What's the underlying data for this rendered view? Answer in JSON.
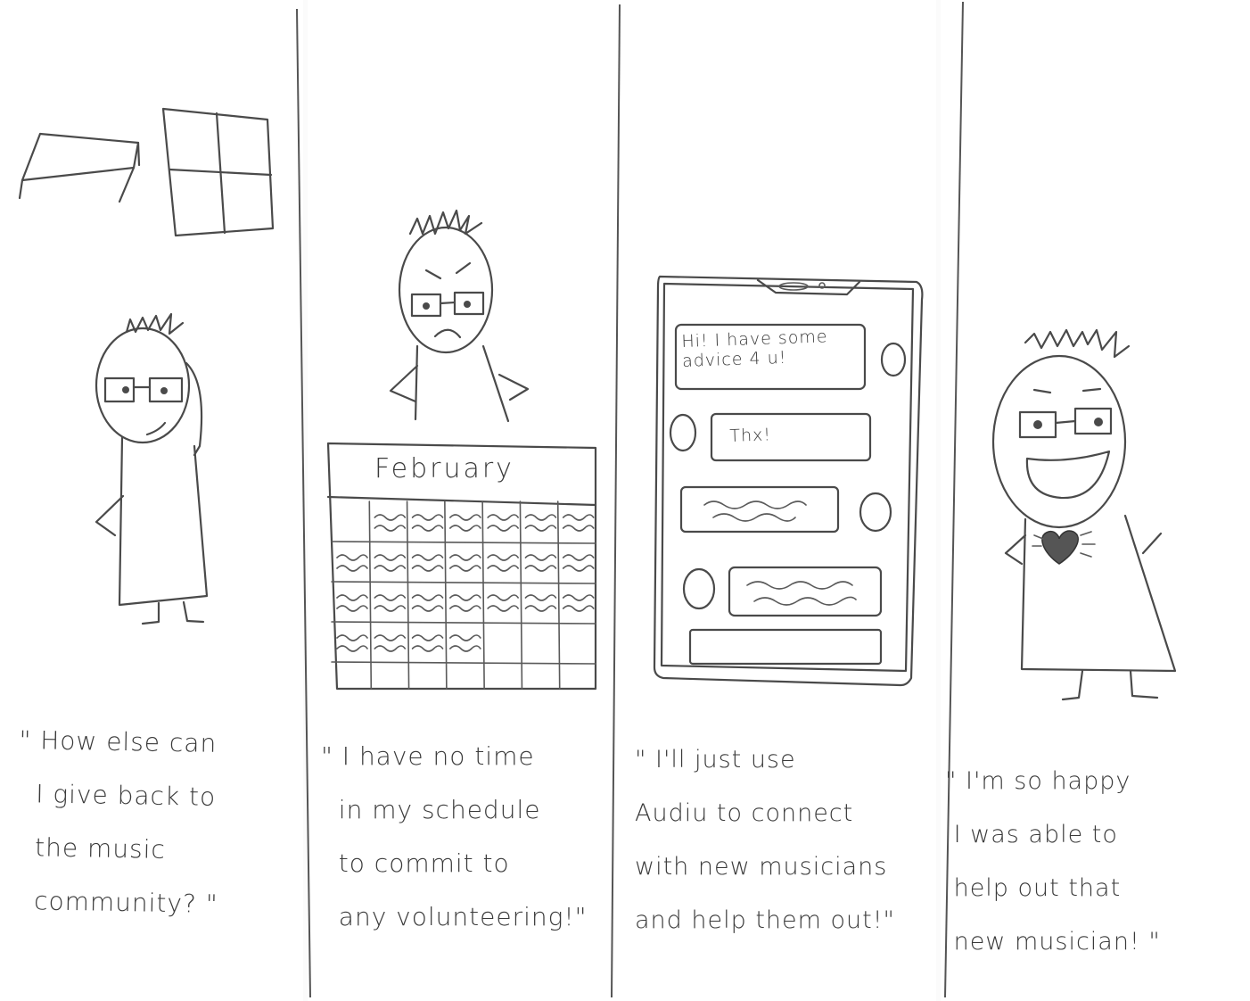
{
  "panels": [
    {
      "caption": "\" How else can\n  I give back to\n  the music\n  community? \""
    },
    {
      "calendar_month": "February",
      "caption": "\" I have no time\n  in my schedule\n  to commit to\n  any volunteering!\""
    },
    {
      "chat": {
        "incoming_message": "Hi! I have some\nadvice 4 u!",
        "reply_message": "Thx!"
      },
      "caption": "\" I'll just use\nAudiu to connect\nwith new musicians\nand help them out!\""
    },
    {
      "caption": "\" I'm so happy\n I was able to\n help out that\n new musician! \""
    }
  ],
  "calendar_chart": {
    "type": "table",
    "title": "February",
    "rows": 4,
    "columns": 7
  }
}
